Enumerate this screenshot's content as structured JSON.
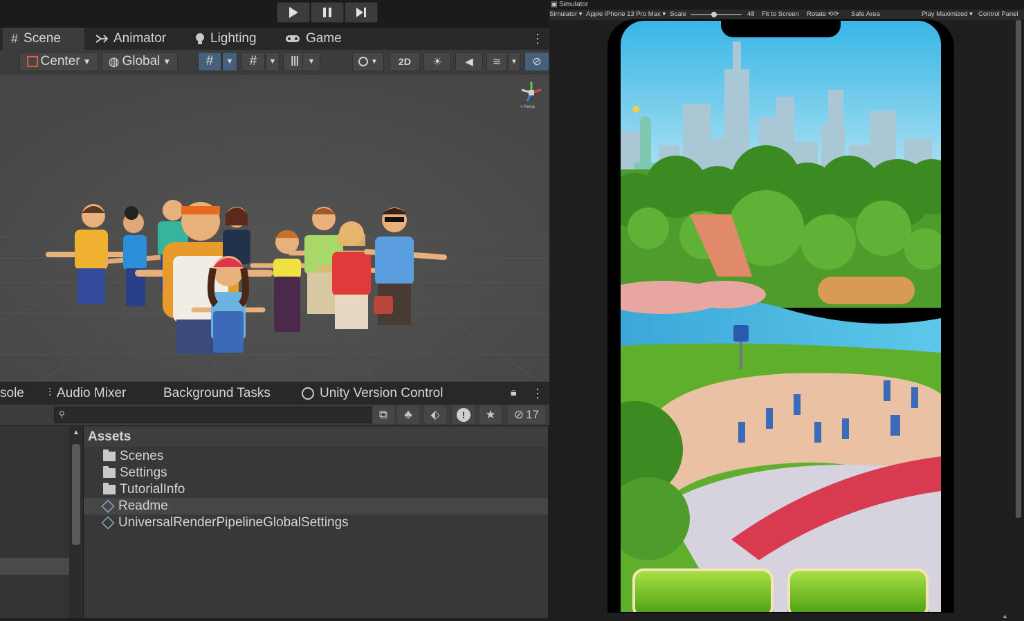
{
  "playbar": {
    "play_icon": "play-icon",
    "pause_icon": "pause-icon",
    "step_icon": "step-icon"
  },
  "tabs": [
    {
      "label": "Scene",
      "icon": "hash-icon"
    },
    {
      "label": "Animator",
      "icon": "animator-icon"
    },
    {
      "label": "Lighting",
      "icon": "bulb-icon"
    },
    {
      "label": "Game",
      "icon": "gamepad-icon"
    }
  ],
  "toolbar": {
    "pivot_label": "Center",
    "space_label": "Global",
    "mode_2d": "2D"
  },
  "gizmo": {
    "label": "< Persp"
  },
  "bottom_tabs": [
    {
      "label": "sole"
    },
    {
      "label": "Audio Mixer"
    },
    {
      "label": "Background Tasks"
    },
    {
      "label": "Unity Version Control"
    }
  ],
  "search": {
    "placeholder": ""
  },
  "hidden_count": "17",
  "files": {
    "root": "Assets",
    "items": [
      {
        "name": "Scenes",
        "kind": "folder"
      },
      {
        "name": "Settings",
        "kind": "folder"
      },
      {
        "name": "TutorialInfo",
        "kind": "folder"
      },
      {
        "name": "Readme",
        "kind": "asset"
      },
      {
        "name": "UniversalRenderPipelineGlobalSettings",
        "kind": "asset"
      }
    ]
  },
  "simulator": {
    "window_title": "Simulator",
    "mode": "Simulator",
    "device": "Apple iPhone 13 Pro Max",
    "scale_label": "Scale",
    "scale_value": "48",
    "fit": "Fit to Screen",
    "rotate": "Rotate",
    "safe_area": "Safe Area",
    "play_mode": "Play Maximized",
    "control_panel": "Control Panel"
  },
  "colors": {
    "accent": "#46607c",
    "game_button": "#6cc42a",
    "sky": "#5ec6ea",
    "grass": "#5fae2c"
  }
}
